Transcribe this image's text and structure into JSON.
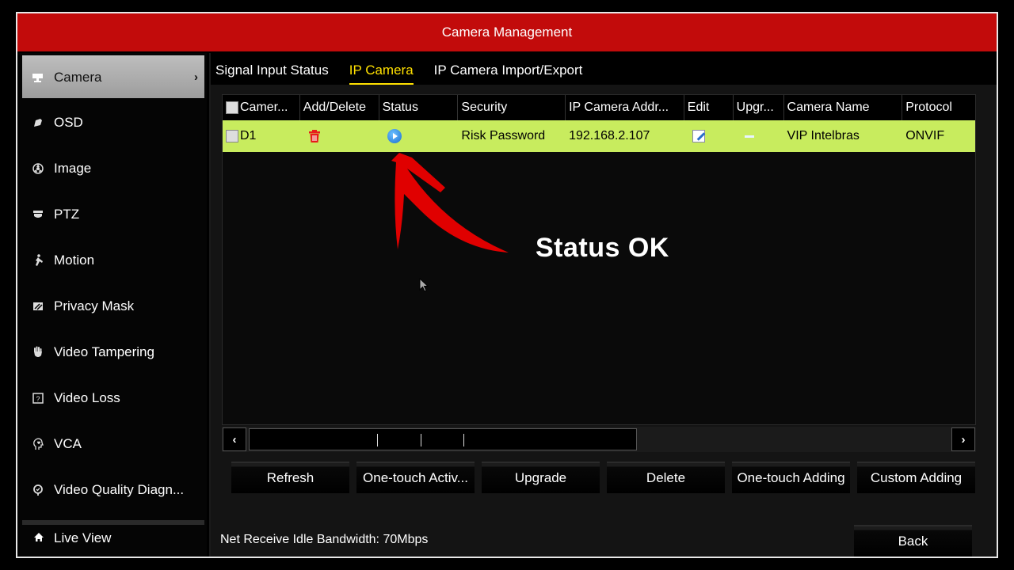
{
  "window": {
    "title": "Camera Management"
  },
  "sidebar": {
    "items": [
      {
        "label": "Camera",
        "icon": "camera-icon",
        "active": true
      },
      {
        "label": "OSD",
        "icon": "osd-icon"
      },
      {
        "label": "Image",
        "icon": "image-icon"
      },
      {
        "label": "PTZ",
        "icon": "ptz-icon"
      },
      {
        "label": "Motion",
        "icon": "motion-icon"
      },
      {
        "label": "Privacy Mask",
        "icon": "privacy-mask-icon"
      },
      {
        "label": "Video Tampering",
        "icon": "hand-icon"
      },
      {
        "label": "Video Loss",
        "icon": "question-box-icon"
      },
      {
        "label": "VCA",
        "icon": "head-icon"
      },
      {
        "label": "Video Quality Diagn...",
        "icon": "check-circle-icon"
      }
    ],
    "live_view": {
      "label": "Live View",
      "icon": "home-icon"
    },
    "chevron": "›"
  },
  "tabs": [
    {
      "label": "Signal Input Status",
      "active": false
    },
    {
      "label": "IP Camera",
      "active": true
    },
    {
      "label": "IP Camera Import/Export",
      "active": false
    }
  ],
  "table": {
    "columns": [
      "Camer...",
      "Add/Delete",
      "Status",
      "Security",
      "IP Camera Addr...",
      "Edit",
      "Upgr...",
      "Camera Name",
      "Protocol"
    ],
    "rows": [
      {
        "camera": "D1",
        "add_delete": "delete-icon",
        "status": "play-icon",
        "security": "Risk Password",
        "ip": "192.168.2.107",
        "edit": "edit-icon",
        "upgrade": "—",
        "camera_name": "VIP Intelbras",
        "protocol": "ONVIF"
      }
    ],
    "row_highlight_color": "#c8ec5e"
  },
  "scrollbar": {
    "left": "‹",
    "right": "›"
  },
  "buttons": {
    "refresh": "Refresh",
    "one_touch_activate": "One-touch Activ...",
    "upgrade": "Upgrade",
    "delete": "Delete",
    "one_touch_adding": "One-touch Adding",
    "custom_adding": "Custom Adding",
    "back": "Back"
  },
  "status": {
    "bandwidth": "Net Receive Idle Bandwidth: 70Mbps"
  },
  "annotation": {
    "text": "Status OK",
    "color": "#e00000"
  },
  "colors": {
    "titlebar": "#c20b0b",
    "active_tab": "#ffe000"
  }
}
